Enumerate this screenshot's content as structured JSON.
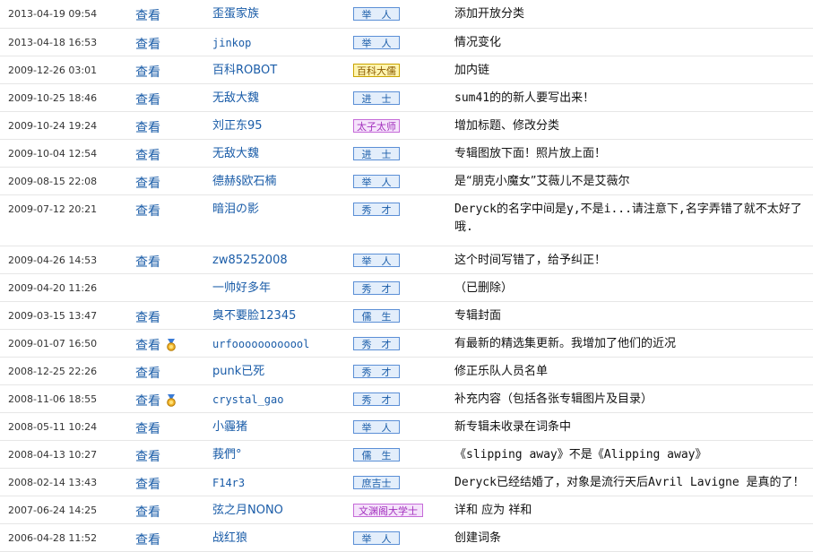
{
  "history": [
    {
      "time": "2013-04-19 09:54",
      "view": "查看",
      "medal": false,
      "user": "歪蛋家族",
      "user_mono": false,
      "rank": "举　人",
      "rank_style": "blue",
      "note": "添加开放分类"
    },
    {
      "time": "2013-04-18 16:53",
      "view": "查看",
      "medal": false,
      "user": "jinkop",
      "user_mono": true,
      "rank": "举　人",
      "rank_style": "blue",
      "note": "情况变化"
    },
    {
      "time": "2009-12-26 03:01",
      "view": "查看",
      "medal": false,
      "user": "百科ROBOT",
      "user_mono": false,
      "rank": "百科大儒",
      "rank_style": "gold",
      "note": "加内链"
    },
    {
      "time": "2009-10-25 18:46",
      "view": "查看",
      "medal": false,
      "user": "无敌大魏",
      "user_mono": false,
      "rank": "进　士",
      "rank_style": "blue",
      "note": "sum41的的新人要写出来！"
    },
    {
      "time": "2009-10-24 19:24",
      "view": "查看",
      "medal": false,
      "user": "刘正东95",
      "user_mono": false,
      "rank": "太子太师",
      "rank_style": "purple",
      "note": "增加标题、修改分类"
    },
    {
      "time": "2009-10-04 12:54",
      "view": "查看",
      "medal": false,
      "user": "无敌大魏",
      "user_mono": false,
      "rank": "进　士",
      "rank_style": "blue",
      "note": "专辑图放下面！照片放上面！"
    },
    {
      "time": "2009-08-15 22:08",
      "view": "查看",
      "medal": false,
      "user": "德赫§欧石楠",
      "user_mono": false,
      "rank": "举　人",
      "rank_style": "blue",
      "note": "是“朋克小魔女”艾薇儿不是艾薇尔"
    },
    {
      "time": "2009-07-12 20:21",
      "view": "查看",
      "medal": false,
      "user": "暗泪の影",
      "user_mono": false,
      "rank": "秀　才",
      "rank_style": "blue",
      "note": "Deryck的名字中间是y,不是i...请注意下,名字弄错了就不太好了哦.",
      "tall": true
    },
    {
      "time": "2009-04-26 14:53",
      "view": "查看",
      "medal": false,
      "user": "zw85252008",
      "user_mono": false,
      "rank": "举　人",
      "rank_style": "blue",
      "note": "这个时间写错了，给予纠正！"
    },
    {
      "time": "2009-04-20 11:26",
      "view": "",
      "medal": false,
      "user": "一帅好多年",
      "user_mono": false,
      "rank": "秀　才",
      "rank_style": "blue",
      "note": "（已删除）"
    },
    {
      "time": "2009-03-15 13:47",
      "view": "查看",
      "medal": false,
      "user": "臭不要脸12345",
      "user_mono": false,
      "rank": "儒　生",
      "rank_style": "blue",
      "note": "专辑封面"
    },
    {
      "time": "2009-01-07 16:50",
      "view": "查看",
      "medal": true,
      "user": "urfoooooooooool",
      "user_mono": true,
      "rank": "秀　才",
      "rank_style": "blue",
      "note": "有最新的精选集更新。我增加了他们的近况"
    },
    {
      "time": "2008-12-25 22:26",
      "view": "查看",
      "medal": false,
      "user": "punk已死",
      "user_mono": false,
      "rank": "秀　才",
      "rank_style": "blue",
      "note": "修正乐队人员名单"
    },
    {
      "time": "2008-11-06 18:55",
      "view": "查看",
      "medal": true,
      "user": "crystal_gao",
      "user_mono": true,
      "rank": "秀　才",
      "rank_style": "blue",
      "note": "补充内容（包括各张专辑图片及目录）"
    },
    {
      "time": "2008-05-11 10:24",
      "view": "查看",
      "medal": false,
      "user": "小霾猪",
      "user_mono": false,
      "rank": "举　人",
      "rank_style": "blue",
      "note": "新专辑未收录在词条中"
    },
    {
      "time": "2008-04-13 10:27",
      "view": "查看",
      "medal": false,
      "user": "莪們°",
      "user_mono": false,
      "rank": "儒　生",
      "rank_style": "blue",
      "note": "《slipping away》不是《Alipping away》"
    },
    {
      "time": "2008-02-14 13:43",
      "view": "查看",
      "medal": false,
      "user": "F14r3",
      "user_mono": true,
      "rank": "庶吉士",
      "rank_style": "blue",
      "note": "Deryck已经结婚了，对象是流行天后Avril Lavigne 是真的了！"
    },
    {
      "time": "2007-06-24 14:25",
      "view": "查看",
      "medal": false,
      "user": "弦之月NONO",
      "user_mono": false,
      "rank": "文渊阁大学士",
      "rank_style": "purple",
      "note": "详和 应为 祥和"
    },
    {
      "time": "2006-04-28 11:52",
      "view": "查看",
      "medal": false,
      "user": "战红狼",
      "user_mono": false,
      "rank": "举　人",
      "rank_style": "blue",
      "note": "创建词条"
    }
  ]
}
